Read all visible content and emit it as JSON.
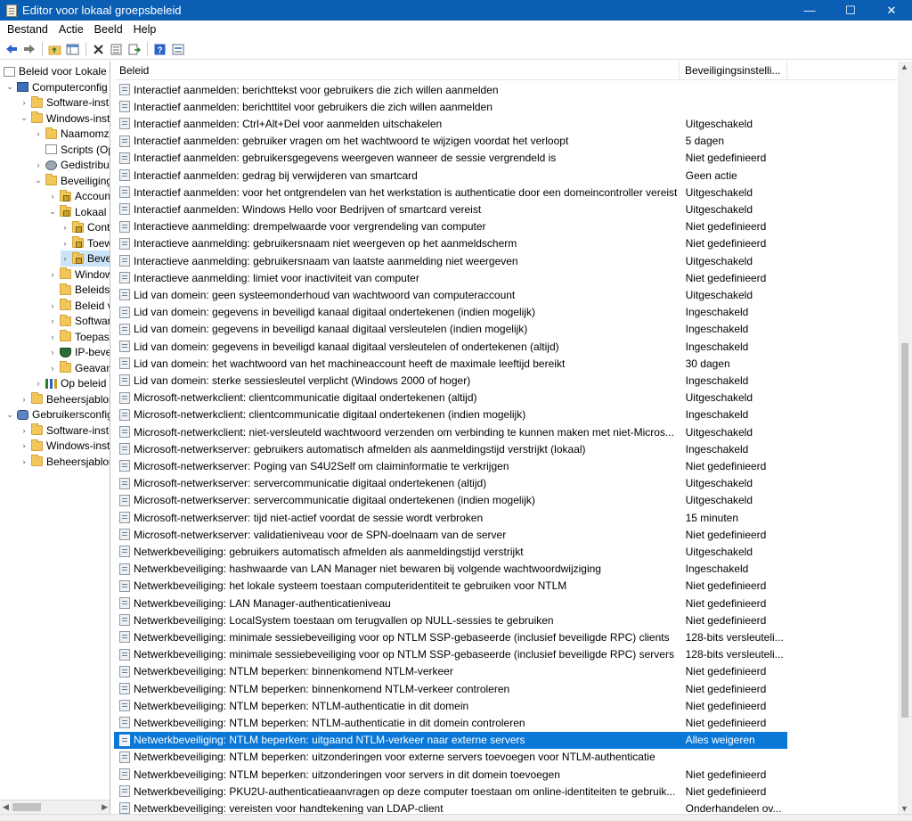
{
  "window": {
    "title": "Editor voor lokaal groepsbeleid",
    "minimize": "—",
    "maximize": "☐",
    "close": "✕"
  },
  "menu": [
    "Bestand",
    "Actie",
    "Beeld",
    "Help"
  ],
  "toolbar": {
    "icons": [
      "back-arrow-icon",
      "forward-arrow-icon",
      "up-folder-icon",
      "show-tree-icon",
      "delete-icon",
      "properties-icon",
      "export-icon",
      "help-icon",
      "view-icon"
    ]
  },
  "tree": [
    {
      "label": "Beleid voor Lokale",
      "level": 0,
      "icon": "doc",
      "toggle": ""
    },
    {
      "label": "Computerconfig",
      "level": 1,
      "icon": "computer",
      "toggle": "v"
    },
    {
      "label": "Software-inst",
      "level": 2,
      "icon": "folder",
      "toggle": ">"
    },
    {
      "label": "Windows-inst",
      "level": 2,
      "icon": "folder",
      "toggle": "v"
    },
    {
      "label": "Naamomz",
      "level": 3,
      "icon": "folder",
      "toggle": ">"
    },
    {
      "label": "Scripts (Op",
      "level": 3,
      "icon": "doc",
      "toggle": ""
    },
    {
      "label": "Gedistribue",
      "level": 3,
      "icon": "gear",
      "toggle": ">"
    },
    {
      "label": "Beveiliging",
      "level": 3,
      "icon": "folder",
      "toggle": "v"
    },
    {
      "label": "Account",
      "level": 4,
      "icon": "lockfolder",
      "toggle": ">"
    },
    {
      "label": "Lokaal b",
      "level": 4,
      "icon": "lockfolder",
      "toggle": "v"
    },
    {
      "label": "Contr",
      "level": 5,
      "icon": "lockfolder",
      "toggle": ">"
    },
    {
      "label": "Toew",
      "level": 5,
      "icon": "lockfolder",
      "toggle": ">"
    },
    {
      "label": "Beve",
      "level": 5,
      "icon": "lockfolder",
      "toggle": ">",
      "selected": true
    },
    {
      "label": "Window",
      "level": 4,
      "icon": "folder",
      "toggle": ">"
    },
    {
      "label": "Beleidsn",
      "level": 4,
      "icon": "folder",
      "toggle": ""
    },
    {
      "label": "Beleid v",
      "level": 4,
      "icon": "folder",
      "toggle": ">"
    },
    {
      "label": "Softwar",
      "level": 4,
      "icon": "folder",
      "toggle": ">"
    },
    {
      "label": "Toepass",
      "level": 4,
      "icon": "folder",
      "toggle": ">"
    },
    {
      "label": "IP-bevei",
      "level": 4,
      "icon": "shield",
      "toggle": ">"
    },
    {
      "label": "Geavand",
      "level": 4,
      "icon": "folder",
      "toggle": ">"
    },
    {
      "label": "Op beleid",
      "level": 3,
      "icon": "chart",
      "toggle": ">"
    },
    {
      "label": "Beheersjablor",
      "level": 2,
      "icon": "folder",
      "toggle": ">"
    },
    {
      "label": "Gebruikersconfig",
      "level": 1,
      "icon": "user",
      "toggle": "v"
    },
    {
      "label": "Software-inst",
      "level": 2,
      "icon": "folder",
      "toggle": ">"
    },
    {
      "label": "Windows-inst",
      "level": 2,
      "icon": "folder",
      "toggle": ">"
    },
    {
      "label": "Beheersjablor",
      "level": 2,
      "icon": "folder",
      "toggle": ">"
    }
  ],
  "columns": {
    "policy": "Beleid",
    "setting": "Beveiligingsinstelli..."
  },
  "policies": [
    {
      "name": "Interactief aanmelden: berichttekst voor gebruikers die zich willen aanmelden",
      "value": ""
    },
    {
      "name": "Interactief aanmelden: berichttitel voor gebruikers die zich willen aanmelden",
      "value": ""
    },
    {
      "name": "Interactief aanmelden: Ctrl+Alt+Del voor aanmelden uitschakelen",
      "value": "Uitgeschakeld"
    },
    {
      "name": "Interactief aanmelden: gebruiker vragen om het wachtwoord te wijzigen voordat het verloopt",
      "value": "5 dagen"
    },
    {
      "name": "Interactief aanmelden: gebruikersgegevens weergeven wanneer de sessie vergrendeld is",
      "value": "Niet gedefinieerd"
    },
    {
      "name": "Interactief aanmelden: gedrag bij verwijderen van smartcard",
      "value": "Geen actie"
    },
    {
      "name": "Interactief aanmelden: voor het ontgrendelen van het werkstation is authenticatie door een domeincontroller vereist",
      "value": "Uitgeschakeld"
    },
    {
      "name": "Interactief aanmelden: Windows Hello voor Bedrijven of smartcard vereist",
      "value": "Uitgeschakeld"
    },
    {
      "name": "Interactieve aanmelding: drempelwaarde voor vergrendeling van computer",
      "value": "Niet gedefinieerd"
    },
    {
      "name": "Interactieve aanmelding: gebruikersnaam niet weergeven op het aanmeldscherm",
      "value": "Niet gedefinieerd"
    },
    {
      "name": "Interactieve aanmelding: gebruikersnaam van laatste aanmelding niet weergeven",
      "value": "Uitgeschakeld"
    },
    {
      "name": "Interactieve aanmelding: limiet voor inactiviteit van computer",
      "value": "Niet gedefinieerd"
    },
    {
      "name": "Lid van domein: geen systeemonderhoud van wachtwoord van computeraccount",
      "value": "Uitgeschakeld"
    },
    {
      "name": "Lid van domein: gegevens in beveiligd kanaal digitaal ondertekenen (indien mogelijk)",
      "value": "Ingeschakeld"
    },
    {
      "name": "Lid van domein: gegevens in beveiligd kanaal digitaal versleutelen (indien mogelijk)",
      "value": "Ingeschakeld"
    },
    {
      "name": "Lid van domein: gegevens in beveiligd kanaal digitaal versleutelen of ondertekenen (altijd)",
      "value": "Ingeschakeld"
    },
    {
      "name": "Lid van domein: het wachtwoord van het machineaccount heeft de maximale leeftijd bereikt",
      "value": "30 dagen"
    },
    {
      "name": "Lid van domein: sterke sessiesleutel verplicht (Windows 2000 of hoger)",
      "value": "Ingeschakeld"
    },
    {
      "name": "Microsoft-netwerkclient: clientcommunicatie digitaal ondertekenen (altijd)",
      "value": "Uitgeschakeld"
    },
    {
      "name": "Microsoft-netwerkclient: clientcommunicatie digitaal ondertekenen (indien mogelijk)",
      "value": "Ingeschakeld"
    },
    {
      "name": "Microsoft-netwerkclient: niet-versleuteld wachtwoord verzenden om verbinding te kunnen maken met niet-Micros...",
      "value": "Uitgeschakeld"
    },
    {
      "name": "Microsoft-netwerkserver: gebruikers automatisch afmelden als aanmeldingstijd verstrijkt (lokaal)",
      "value": "Ingeschakeld"
    },
    {
      "name": "Microsoft-netwerkserver: Poging van S4U2Self om claiminformatie te verkrijgen",
      "value": "Niet gedefinieerd"
    },
    {
      "name": "Microsoft-netwerkserver: servercommunicatie digitaal ondertekenen (altijd)",
      "value": "Uitgeschakeld"
    },
    {
      "name": "Microsoft-netwerkserver: servercommunicatie digitaal ondertekenen (indien mogelijk)",
      "value": "Uitgeschakeld"
    },
    {
      "name": "Microsoft-netwerkserver: tijd niet-actief voordat de sessie wordt verbroken",
      "value": "15 minuten"
    },
    {
      "name": "Microsoft-netwerkserver: validatieniveau voor de SPN-doelnaam van de server",
      "value": "Niet gedefinieerd"
    },
    {
      "name": "Netwerkbeveiliging: gebruikers automatisch afmelden als aanmeldingstijd verstrijkt",
      "value": "Uitgeschakeld"
    },
    {
      "name": "Netwerkbeveiliging: hashwaarde van LAN Manager niet bewaren bij volgende wachtwoordwijziging",
      "value": "Ingeschakeld"
    },
    {
      "name": "Netwerkbeveiliging: het lokale systeem toestaan computeridentiteit te gebruiken voor NTLM",
      "value": "Niet gedefinieerd"
    },
    {
      "name": "Netwerkbeveiliging: LAN Manager-authenticatieniveau",
      "value": "Niet gedefinieerd"
    },
    {
      "name": "Netwerkbeveiliging: LocalSystem toestaan om terugvallen op NULL-sessies te gebruiken",
      "value": "Niet gedefinieerd"
    },
    {
      "name": "Netwerkbeveiliging: minimale sessiebeveiliging voor op NTLM SSP-gebaseerde (inclusief beveiligde RPC) clients",
      "value": "128-bits versleuteli..."
    },
    {
      "name": "Netwerkbeveiliging: minimale sessiebeveiliging voor op NTLM SSP-gebaseerde (inclusief beveiligde RPC) servers",
      "value": "128-bits versleuteli..."
    },
    {
      "name": "Netwerkbeveiliging: NTLM beperken: binnenkomend NTLM-verkeer",
      "value": "Niet gedefinieerd"
    },
    {
      "name": "Netwerkbeveiliging: NTLM beperken: binnenkomend NTLM-verkeer controleren",
      "value": "Niet gedefinieerd"
    },
    {
      "name": "Netwerkbeveiliging: NTLM beperken: NTLM-authenticatie in dit domein",
      "value": "Niet gedefinieerd"
    },
    {
      "name": "Netwerkbeveiliging: NTLM beperken: NTLM-authenticatie in dit domein controleren",
      "value": "Niet gedefinieerd"
    },
    {
      "name": "Netwerkbeveiliging: NTLM beperken: uitgaand NTLM-verkeer naar externe servers",
      "value": "Alles weigeren",
      "selected": true
    },
    {
      "name": "Netwerkbeveiliging: NTLM beperken: uitzonderingen voor externe servers toevoegen voor NTLM-authenticatie",
      "value": ""
    },
    {
      "name": "Netwerkbeveiliging: NTLM beperken: uitzonderingen voor servers in dit domein toevoegen",
      "value": "Niet gedefinieerd"
    },
    {
      "name": "Netwerkbeveiliging: PKU2U-authenticatieaanvragen op deze computer toestaan om online-identiteiten te gebruik...",
      "value": "Niet gedefinieerd"
    },
    {
      "name": "Netwerkbeveiliging: vereisten voor handtekening van LDAP-client",
      "value": "Onderhandelen ov..."
    }
  ]
}
